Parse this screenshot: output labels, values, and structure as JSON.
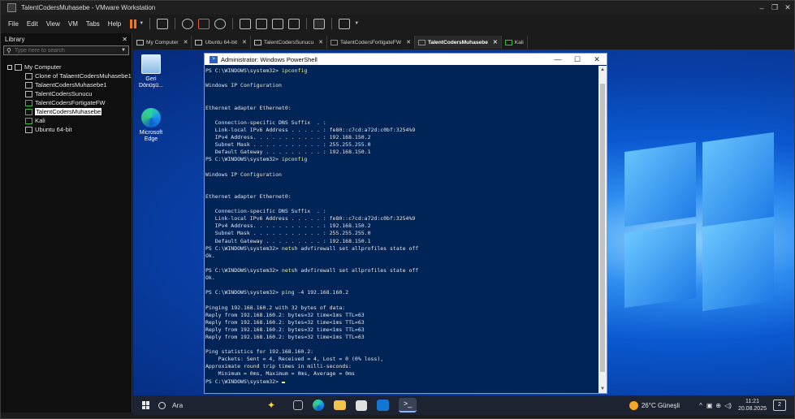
{
  "window": {
    "title": "TalentCodersMuhasebe - VMware Workstation"
  },
  "menu": [
    "File",
    "Edit",
    "View",
    "VM",
    "Tabs",
    "Help"
  ],
  "library": {
    "title": "Library",
    "search_placeholder": "Type here to search",
    "root": "My Computer",
    "items": [
      {
        "label": "Clone of TalaentCodersMuhasebe1",
        "running": false
      },
      {
        "label": "TalaentCodersMuhasebe1",
        "running": false
      },
      {
        "label": "TalentCodersSunucu",
        "running": false
      },
      {
        "label": "TalentCodersFortigateFW",
        "running": true
      },
      {
        "label": "TalentCodersMuhasebe",
        "running": true,
        "selected": true
      },
      {
        "label": "Kali",
        "running": true
      },
      {
        "label": "Ubuntu 64-bit",
        "running": false
      }
    ]
  },
  "tabs": [
    {
      "label": "My Computer",
      "active": false
    },
    {
      "label": "Ubuntu 64-bit",
      "active": false
    },
    {
      "label": "TalentCodersSunucu",
      "active": false
    },
    {
      "label": "TalentCodersFortigateFW",
      "active": false
    },
    {
      "label": "TalentCodersMuhasebe",
      "active": true
    },
    {
      "label": "Kali",
      "active": false
    }
  ],
  "desktop_icons": {
    "recycle_bin": "Geri Dönüşü...",
    "edge": "Microsoft Edge"
  },
  "powershell": {
    "title": "Administrator: Windows PowerShell",
    "lines": [
      {
        "cmd": "PS C:\\WINDOWS\\system32> ",
        "input": "ipconfig"
      },
      {
        "text": ""
      },
      {
        "text": "Windows IP Configuration"
      },
      {
        "text": ""
      },
      {
        "text": ""
      },
      {
        "text": "Ethernet adapter Ethernet0:"
      },
      {
        "text": ""
      },
      {
        "text": "   Connection-specific DNS Suffix  . :"
      },
      {
        "text": "   Link-local IPv6 Address . . . . . : fe80::c7cd:a72d:c0bf:3254%9"
      },
      {
        "text": "   IPv4 Address. . . . . . . . . . . : 192.168.150.2"
      },
      {
        "text": "   Subnet Mask . . . . . . . . . . . : 255.255.255.0"
      },
      {
        "text": "   Default Gateway . . . . . . . . . : 192.168.150.1"
      },
      {
        "cmd": "PS C:\\WINDOWS\\system32> ",
        "input": "ipconfig"
      },
      {
        "text": ""
      },
      {
        "text": "Windows IP Configuration"
      },
      {
        "text": ""
      },
      {
        "text": ""
      },
      {
        "text": "Ethernet adapter Ethernet0:"
      },
      {
        "text": ""
      },
      {
        "text": "   Connection-specific DNS Suffix  . :"
      },
      {
        "text": "   Link-local IPv6 Address . . . . . : fe80::c7cd:a72d:c0bf:3254%9"
      },
      {
        "text": "   IPv4 Address. . . . . . . . . . . : 192.168.150.2"
      },
      {
        "text": "   Subnet Mask . . . . . . . . . . . : 255.255.255.0"
      },
      {
        "text": "   Default Gateway . . . . . . . . . : 192.168.150.1"
      },
      {
        "cmd": "PS C:\\WINDOWS\\system32> ",
        "input": "netsh",
        "rest": " advfirewall set allprofiles state off"
      },
      {
        "text": "Ok."
      },
      {
        "text": ""
      },
      {
        "cmd": "PS C:\\WINDOWS\\system32> ",
        "input": "netsh",
        "rest": " advfirewall set allprofiles state off"
      },
      {
        "text": "Ok."
      },
      {
        "text": ""
      },
      {
        "cmd": "PS C:\\WINDOWS\\system32> ",
        "input": "ping",
        "rest": " -4 192.168.160.2"
      },
      {
        "text": ""
      },
      {
        "text": "Pinging 192.168.160.2 with 32 bytes of data:"
      },
      {
        "text": "Reply from 192.168.160.2: bytes=32 time<1ms TTL=63"
      },
      {
        "text": "Reply from 192.168.160.2: bytes=32 time<1ms TTL=63"
      },
      {
        "text": "Reply from 192.168.160.2: bytes=32 time<1ms TTL=63"
      },
      {
        "text": "Reply from 192.168.160.2: bytes=32 time<1ms TTL=63"
      },
      {
        "text": ""
      },
      {
        "text": "Ping statistics for 192.168.160.2:"
      },
      {
        "text": "    Packets: Sent = 4, Received = 4, Lost = 0 (0% loss),"
      },
      {
        "text": "Approximate round trip times in milli-seconds:"
      },
      {
        "text": "    Minimum = 0ms, Maximum = 0ms, Average = 0ms"
      },
      {
        "cmd": "PS C:\\WINDOWS\\system32> ",
        "input": "",
        "cursor": true
      }
    ]
  },
  "taskbar": {
    "search_label": "Ara",
    "weather": "26°C  Güneşli",
    "time": "11:21",
    "date": "20.08.2025",
    "notification_count": "2"
  },
  "colors": {
    "console_bg": "#012456",
    "command_yellow": "#f5f17a",
    "pause_orange": "#f07a1a",
    "running_green": "#39c239"
  }
}
